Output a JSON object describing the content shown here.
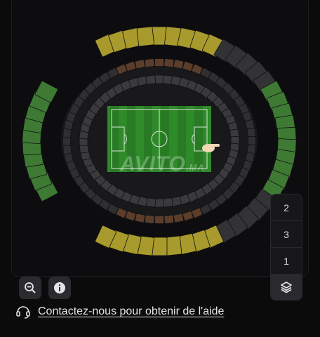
{
  "watermark": {
    "brand": "AVITO",
    "suffix": ".MA"
  },
  "layers": {
    "items": [
      {
        "label": "2"
      },
      {
        "label": "3"
      },
      {
        "label": "1"
      }
    ],
    "toggle_icon": "layers-icon"
  },
  "controls": {
    "zoom_icon": "zoom-out-icon",
    "info_icon": "info-icon"
  },
  "help": {
    "icon": "headset-icon",
    "link_text": "Contactez-nous pour obtenir de l'aide"
  },
  "colors": {
    "pitch": "#2f8a2a",
    "section_green": "#3e7a33",
    "section_yellow": "#a89a2c",
    "section_dark": "#3a3a3d",
    "section_brown": "#5a3d2b",
    "background": "#0b0b0c"
  }
}
